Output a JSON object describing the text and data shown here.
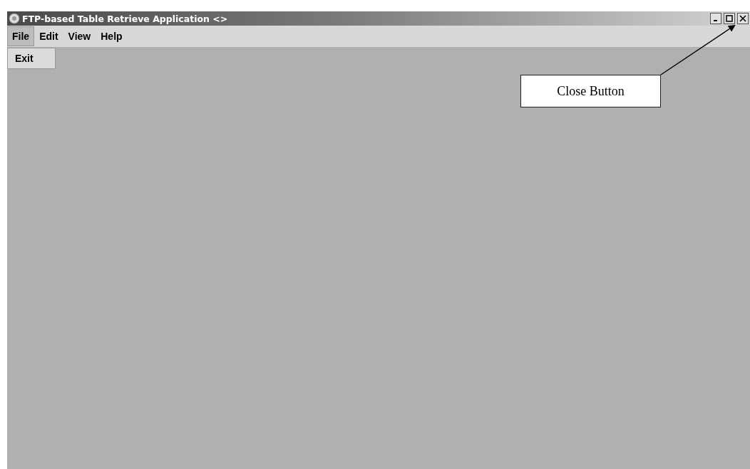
{
  "window": {
    "title": "FTP-based Table Retrieve Application <>"
  },
  "menu_bar": [
    {
      "label": "File",
      "selected": true
    },
    {
      "label": "Edit",
      "selected": false
    },
    {
      "label": "View",
      "selected": false
    },
    {
      "label": "Help",
      "selected": false
    }
  ],
  "open_menu": {
    "items": [
      "Exit"
    ]
  },
  "annotation": {
    "label": "Close Button"
  }
}
